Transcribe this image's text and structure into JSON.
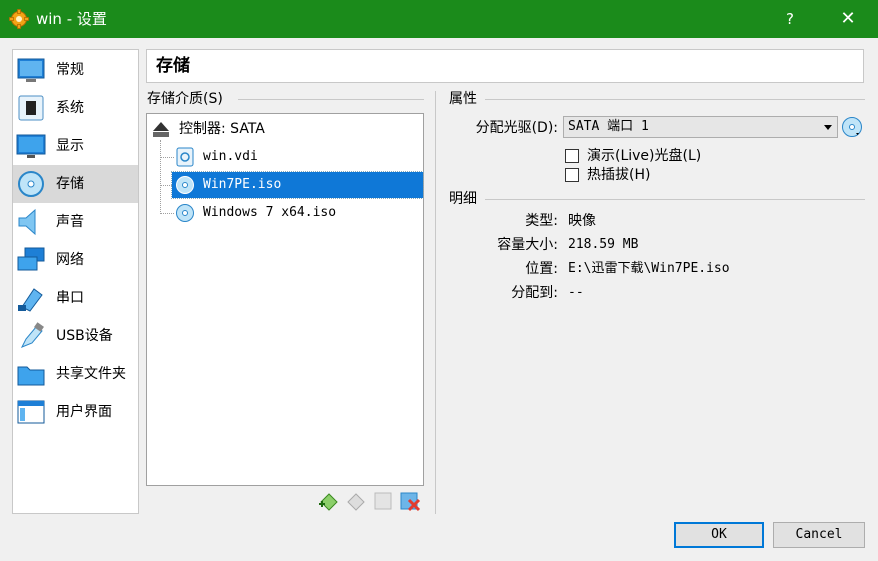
{
  "window": {
    "title": "win - 设置",
    "help_label": "?",
    "close_label": "✕"
  },
  "sidebar": {
    "items": [
      {
        "label": "常规",
        "icon": "general-icon"
      },
      {
        "label": "系统",
        "icon": "system-chip-icon"
      },
      {
        "label": "显示",
        "icon": "display-monitor-icon"
      },
      {
        "label": "存储",
        "icon": "storage-disk-icon",
        "selected": true
      },
      {
        "label": "声音",
        "icon": "speaker-icon"
      },
      {
        "label": "网络",
        "icon": "network-icon"
      },
      {
        "label": "串口",
        "icon": "serial-port-icon"
      },
      {
        "label": "USB设备",
        "icon": "usb-icon"
      },
      {
        "label": "共享文件夹",
        "icon": "shared-folder-icon"
      },
      {
        "label": "用户界面",
        "icon": "user-interface-icon"
      }
    ]
  },
  "page_title": "存储",
  "storage": {
    "header": "存储介质(S)",
    "controller": "控制器: SATA",
    "devices": [
      {
        "label": "win.vdi",
        "icon": "hard-disk-icon"
      },
      {
        "label": "Win7PE.iso",
        "icon": "optical-disc-icon",
        "selected": true
      },
      {
        "label": "Windows 7 x64.iso",
        "icon": "optical-disc-icon"
      }
    ]
  },
  "attributes": {
    "header": "属性",
    "drive_label": "分配光驱(D):",
    "drive_value": "SATA 端口 1",
    "live_cd_label": "演示(Live)光盘(L)",
    "live_cd_checked": false,
    "hotplug_label": "热插拔(H)",
    "hotplug_checked": false
  },
  "details": {
    "header": "明细",
    "rows": [
      {
        "label": "类型:",
        "value": "映像"
      },
      {
        "label": "容量大小:",
        "value": "218.59  MB"
      },
      {
        "label": "位置:",
        "value": "E:\\迅雷下载\\Win7PE.iso"
      },
      {
        "label": "分配到:",
        "value": "--"
      }
    ]
  },
  "buttons": {
    "ok": "OK",
    "cancel": "Cancel"
  },
  "colors": {
    "titlebar": "#1b8b1b",
    "selection": "#0f78d7",
    "sidebar_selected": "#d9d9d9"
  }
}
